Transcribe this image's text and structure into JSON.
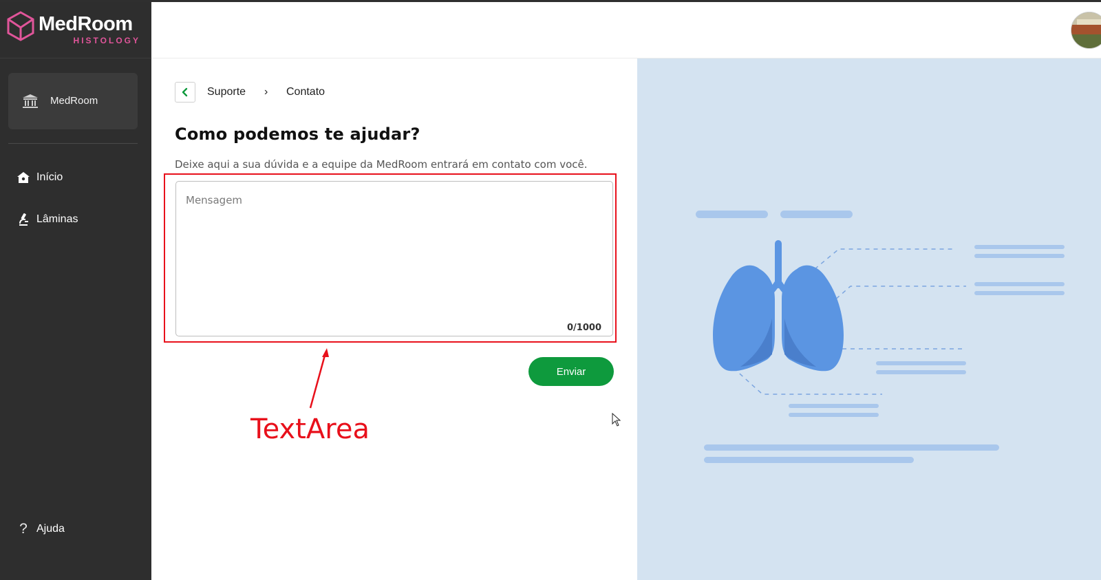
{
  "app": {
    "brand_name": "MedRoom",
    "brand_sub": "HISTOLOGY",
    "colors": {
      "sidebar": "#2e2e2e",
      "accent_green": "#0e9a3d",
      "brand_pink": "#e0559a",
      "annotation_red": "#e8101b",
      "illustration_bg": "#d4e3f1",
      "lung_blue": "#5b95e2"
    }
  },
  "sidebar": {
    "org": {
      "label": "MedRoom",
      "icon": "institution-icon"
    },
    "items": [
      {
        "label": "Início",
        "icon": "home-icon"
      },
      {
        "label": "Lâminas",
        "icon": "microscope-icon"
      }
    ],
    "help": {
      "label": "Ajuda",
      "icon": "question-icon"
    }
  },
  "header": {
    "avatar": "user-avatar"
  },
  "breadcrumb": {
    "back_icon": "chevron-left-icon",
    "items": [
      "Suporte",
      "Contato"
    ],
    "separator": "›"
  },
  "form": {
    "title": "Como podemos te ajudar?",
    "subtitle": "Deixe aqui a sua dúvida e a equipe da MedRoom entrará em contato com você.",
    "message_placeholder": "Mensagem",
    "message_value": "",
    "counter": "0/1000",
    "submit_label": "Enviar"
  },
  "annotation": {
    "label": "TextArea"
  }
}
